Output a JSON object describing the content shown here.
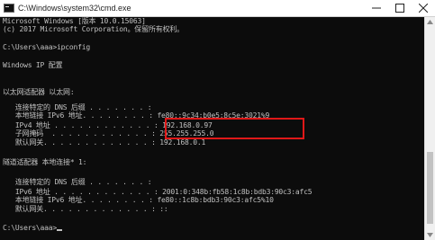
{
  "window": {
    "title": "C:\\Windows\\system32\\cmd.exe",
    "icons": [
      "cmd-icon",
      "minimize-icon",
      "maximize-icon",
      "close-icon"
    ]
  },
  "console": {
    "lines": [
      "Microsoft Windows [版本 10.0.15063]",
      "(c) 2017 Microsoft Corporation。保留所有权利。",
      "",
      "C:\\Users\\aaa>ipconfig",
      "",
      "Windows IP 配置",
      "",
      "",
      "以太网适配器 以太网:",
      "",
      "   连接特定的 DNS 后缀 . . . . . . . :",
      "   本地链接 IPv6 地址. . . . . . . . : fe80::9c34:b0e5:8c5e:3021%9",
      "   IPv4 地址 . . . . . . . . . . . . : 192.168.0.97",
      "   子网掩码  . . . . . . . . . . . . : 255.255.255.0",
      "   默认网关. . . . . . . . . . . . . : 192.168.0.1",
      "",
      "隧道适配器 本地连接* 1:",
      "",
      "   连接特定的 DNS 后缀 . . . . . . . :",
      "   IPv6 地址 . . . . . . . . . . . . : 2001:0:348b:fb58:1c8b:bdb3:90c3:afc5",
      "   本地链接 IPv6 地址. . . . . . . . : fe80::1c8b:bdb3:90c3:afc5%10",
      "   默认网关. . . . . . . . . . . . . : ::",
      "",
      "C:\\Users\\aaa>"
    ]
  },
  "highlight": {
    "color": "#e01818"
  }
}
